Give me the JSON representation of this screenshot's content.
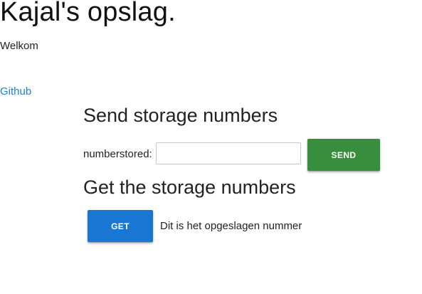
{
  "header": {
    "title": "Kajal's opslag.",
    "welcome": "Welkom"
  },
  "links": {
    "github": "Github"
  },
  "send_section": {
    "heading": "Send storage numbers",
    "field_label": "numberstored:",
    "input_value": "",
    "input_placeholder": "",
    "send_label": "SEND",
    "send_color": "#388e3c"
  },
  "get_section": {
    "heading": "Get the storage numbers",
    "get_label": "GET",
    "get_color": "#1976d2",
    "result_text": "Dit is het opgeslagen nummer"
  },
  "colors": {
    "link": "#1e80d8"
  }
}
